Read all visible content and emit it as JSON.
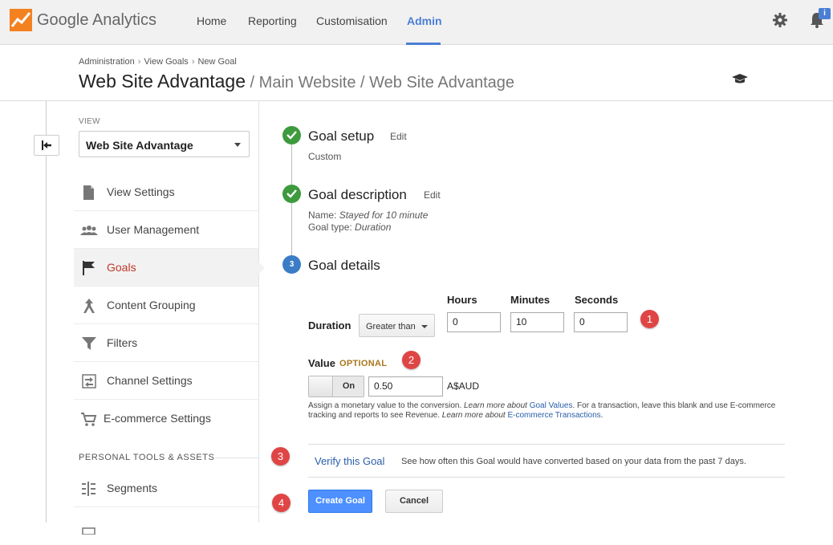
{
  "app": {
    "brand_google": "Google",
    "brand_product": "Analytics"
  },
  "nav": {
    "home": "Home",
    "reporting": "Reporting",
    "customisation": "Customisation",
    "admin": "Admin"
  },
  "notifications": {
    "badge": "i"
  },
  "breadcrumb": [
    "Administration",
    "View Goals",
    "New Goal"
  ],
  "page": {
    "title": "Web Site Advantage",
    "subtitle": " / Main Website / Web Site Advantage"
  },
  "sidebar": {
    "view_label": "VIEW",
    "view_selected": "Web Site Advantage",
    "items": [
      {
        "label": "View Settings",
        "icon": "document-icon",
        "active": false
      },
      {
        "label": "User Management",
        "icon": "users-icon",
        "active": false
      },
      {
        "label": "Goals",
        "icon": "flag-icon",
        "active": true
      },
      {
        "label": "Content Grouping",
        "icon": "content-grouping-icon",
        "active": false
      },
      {
        "label": "Filters",
        "icon": "filter-icon",
        "active": false
      },
      {
        "label": "Channel Settings",
        "icon": "channel-icon",
        "active": false
      },
      {
        "label": "E-commerce Settings",
        "icon": "cart-icon",
        "active": false
      }
    ],
    "section_label": "PERSONAL TOOLS & ASSETS",
    "tools": [
      {
        "label": "Segments",
        "icon": "segments-icon"
      }
    ]
  },
  "steps": {
    "setup": {
      "title": "Goal setup",
      "edit": "Edit",
      "detail": "Custom"
    },
    "description": {
      "title": "Goal description",
      "edit": "Edit",
      "name_label": "Name:",
      "name_value": "Stayed for 10 minute",
      "type_label": "Goal type:",
      "type_value": "Duration"
    },
    "details": {
      "number": "3",
      "title": "Goal details"
    }
  },
  "duration": {
    "label": "Duration",
    "comparator": "Greater than",
    "hours_label": "Hours",
    "minutes_label": "Minutes",
    "seconds_label": "Seconds",
    "hours": "0",
    "minutes": "10",
    "seconds": "0"
  },
  "value": {
    "label": "Value",
    "optional": "OPTIONAL",
    "toggle": "On",
    "amount": "0.50",
    "currency": "A$AUD",
    "help_1": "Assign a monetary value to the conversion. ",
    "help_learn_1": "Learn more about ",
    "help_link_1": "Goal Values",
    "help_2": ". For a transaction, leave this blank and use E-commerce tracking and reports to see Revenue. ",
    "help_learn_2": "Learn more about ",
    "help_link_2": "E-commerce Transactions",
    "help_3": "."
  },
  "verify": {
    "link": "Verify this Goal",
    "description": "See how often this Goal would have converted based on your data from the past 7 days."
  },
  "buttons": {
    "create": "Create Goal",
    "cancel": "Cancel"
  },
  "annotations": [
    "1",
    "2",
    "3",
    "4"
  ],
  "colors": {
    "accent": "#4a7fd4",
    "active_item": "#c0392b",
    "check": "#3d9a3d",
    "badge": "#e04545",
    "primary_button": "#4d90fe"
  }
}
